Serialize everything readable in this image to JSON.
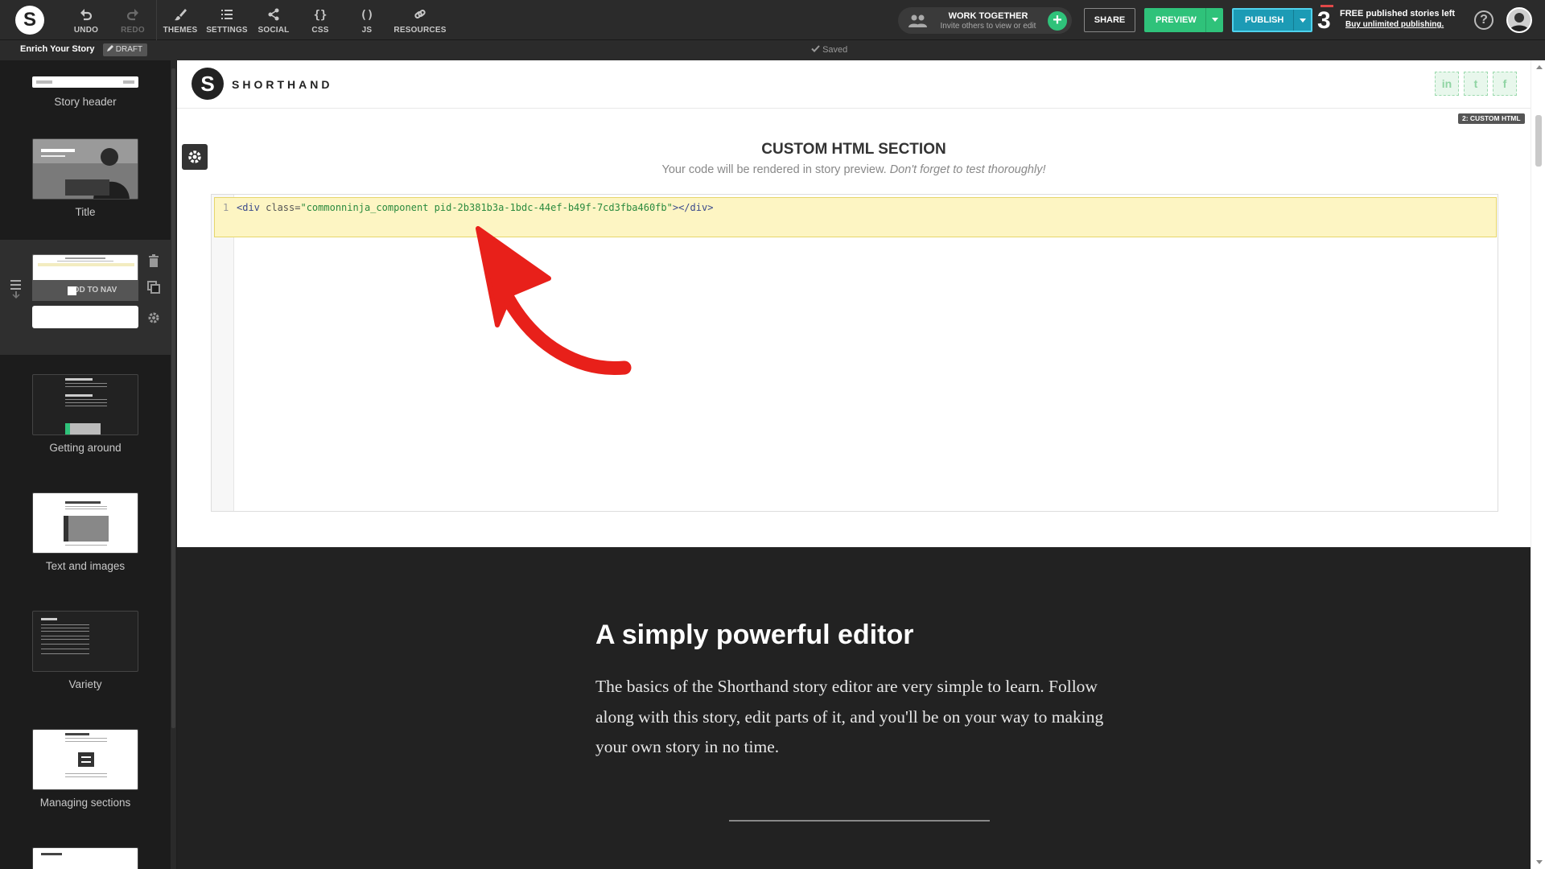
{
  "toolbar": {
    "logo": "S",
    "tools": [
      {
        "id": "undo",
        "label": "UNDO"
      },
      {
        "id": "redo",
        "label": "REDO"
      },
      {
        "id": "themes",
        "label": "THEMES"
      },
      {
        "id": "settings",
        "label": "SETTINGS"
      },
      {
        "id": "social",
        "label": "SOCIAL"
      },
      {
        "id": "css",
        "label": "CSS"
      },
      {
        "id": "js",
        "label": "JS"
      },
      {
        "id": "resources",
        "label": "RESOURCES"
      }
    ],
    "work_together": {
      "title": "WORK TOGETHER",
      "subtitle": "Invite others to view or edit"
    },
    "share_label": "SHARE",
    "preview_label": "PREVIEW",
    "publish_label": "PUBLISH",
    "free_count": "3",
    "free_title": "FREE published stories left",
    "free_link": "Buy unlimited publishing."
  },
  "subbar": {
    "story_title": "Enrich Your Story",
    "draft_label": "DRAFT",
    "saved_label": "Saved"
  },
  "sidebar": {
    "sections": [
      {
        "label": "Story header"
      },
      {
        "label": "Title"
      },
      {
        "label": ""
      },
      {
        "label": "Getting around"
      },
      {
        "label": "Text and images"
      },
      {
        "label": "Variety"
      },
      {
        "label": "Managing sections"
      }
    ],
    "add_to_nav_label": "ADD TO NAV"
  },
  "story": {
    "logo": "S",
    "brand": "SHORTHAND",
    "social": [
      "in",
      "t",
      "f"
    ],
    "badge": "2: CUSTOM HTML",
    "custom_html": {
      "title": "CUSTOM HTML SECTION",
      "subtitle": "Your code will be rendered in story preview.",
      "subtitle_em": "Don't forget to test thoroughly!",
      "line_number": "1",
      "code_open": "<div",
      "code_attr": " class=",
      "code_value": "\"commonninja_component pid-2b381b3a-1bdc-44ef-b49f-7cd3fba460fb\"",
      "code_close": "></div>"
    },
    "next_section": {
      "heading": "A simply powerful editor",
      "body": "The basics of the Shorthand story editor are very simple to learn. Follow along with this story, edit parts of it, and you'll be on your way to making your own story in no time."
    }
  },
  "colors": {
    "accent_green": "#2fc27a",
    "publish_blue": "#1c9bb5",
    "annotation_red": "#e8201a",
    "code_highlight": "#fdf5c3"
  }
}
